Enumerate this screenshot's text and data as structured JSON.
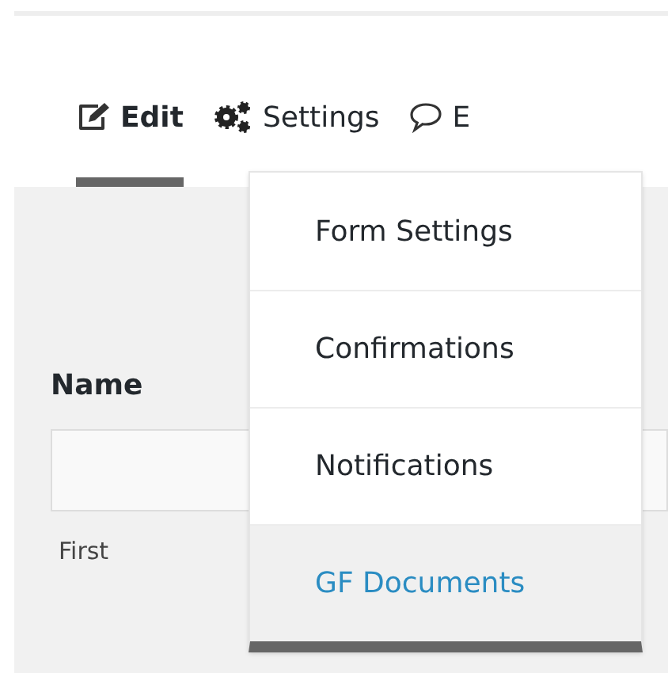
{
  "tabs": [
    {
      "label": "Edit",
      "selected": true
    },
    {
      "label": "Settings",
      "selected": false
    },
    {
      "label": "E",
      "selected": false
    }
  ],
  "field": {
    "label": "Name",
    "sublabel": "First"
  },
  "menu": [
    {
      "label": "Form Settings",
      "selected": false
    },
    {
      "label": "Confirmations",
      "selected": false
    },
    {
      "label": "Notifications",
      "selected": false
    },
    {
      "label": "GF Documents",
      "selected": true
    }
  ]
}
